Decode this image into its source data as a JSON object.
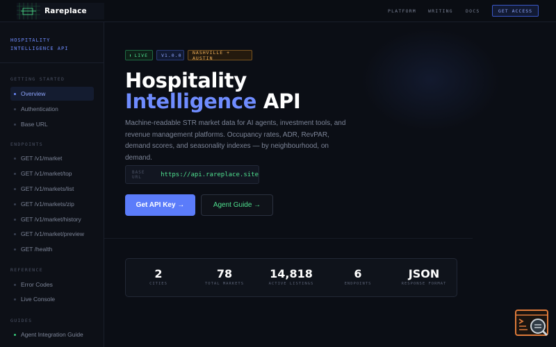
{
  "brand": {
    "name": "Rareplace"
  },
  "nav": {
    "links": [
      "PLATFORM",
      "WRITING",
      "DOCS"
    ],
    "cta": "GET ACCESS"
  },
  "sidebar": {
    "title": "HOSPITALITY INTELLIGENCE API",
    "sections": [
      {
        "label": "GETTING STARTED",
        "items": [
          "Overview",
          "Authentication",
          "Base URL"
        ]
      },
      {
        "label": "ENDPOINTS",
        "items": [
          "GET /v1/market",
          "GET /v1/market/top",
          "GET /v1/markets/list",
          "GET /v1/markets/zip",
          "GET /v1/market/history",
          "GET /v1/market/preview",
          "GET /health"
        ]
      },
      {
        "label": "REFERENCE",
        "items": [
          "Error Codes",
          "Live Console"
        ]
      },
      {
        "label": "GUIDES",
        "items": [
          "Agent Integration Guide"
        ]
      }
    ]
  },
  "hero": {
    "badges": {
      "live": "LIVE",
      "version": "V1.0.0",
      "location": "NASHVILLE + AUSTIN"
    },
    "title_line1": "Hospitality",
    "title_accent": "Intelligence",
    "title_rest": "API",
    "description": "Machine-readable STR market data for AI agents, investment tools, and revenue management platforms. Occupancy rates, ADR, RevPAR, demand scores, and seasonality indexes — by neighbourhood, on demand.",
    "base_url_label": "BASE URL",
    "base_url": "https://api.rareplace.site",
    "primary_button": "Get API Key →",
    "secondary_button": "Agent Guide →"
  },
  "stats": [
    {
      "value": "2",
      "label": "CITIES"
    },
    {
      "value": "78",
      "label": "TOTAL MARKETS"
    },
    {
      "value": "14,818",
      "label": "ACTIVE LISTINGS"
    },
    {
      "value": "6",
      "label": "ENDPOINTS"
    },
    {
      "value": "JSON",
      "label": "RESPONSE FORMAT"
    }
  ],
  "colors": {
    "accent": "#6f8cff",
    "live_green": "#4fe08f",
    "location_amber": "#f3b25a",
    "background": "#0b0e15"
  },
  "icons": {
    "widget": "terminal-search-icon"
  }
}
